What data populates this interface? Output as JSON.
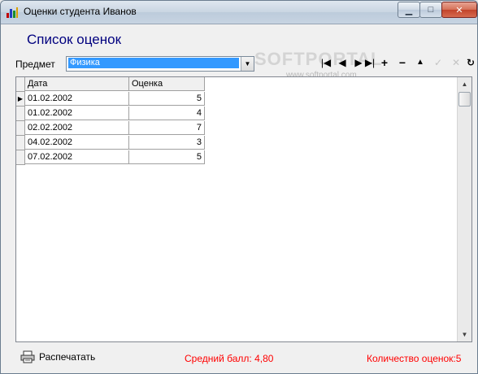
{
  "window": {
    "title": "Оценки студента Иванов",
    "minimize_glyph": "▁",
    "maximize_glyph": "□",
    "close_glyph": "✕"
  },
  "heading": "Список оценок",
  "subject": {
    "label": "Предмет",
    "value": "Физика",
    "dropdown_glyph": "▼"
  },
  "navigator": {
    "first": "|◀",
    "prior": "◀",
    "next": "▶",
    "last": "▶|",
    "insert": "+",
    "delete": "−",
    "edit": "▲",
    "post": "✓",
    "cancel": "✕",
    "refresh": "↻"
  },
  "watermark": {
    "text": "SOFTPORTAL",
    "sub": "www.softportal.com"
  },
  "grid": {
    "columns": [
      "Дата",
      "Оценка"
    ],
    "current_row_marker": "▶",
    "rows": [
      {
        "date": "01.02.2002",
        "grade": "5"
      },
      {
        "date": "01.02.2002",
        "grade": "4"
      },
      {
        "date": "02.02.2002",
        "grade": "7"
      },
      {
        "date": "04.02.2002",
        "grade": "3"
      },
      {
        "date": "07.02.2002",
        "grade": "5"
      }
    ],
    "scroll_up": "▲",
    "scroll_down": "▼"
  },
  "footer": {
    "print_label": "Распечатать",
    "average": "Средний балл: 4,80",
    "count": "Количество оценок:5"
  },
  "colors": {
    "heading": "#00007f",
    "selection": "#3399ff",
    "summary_text": "#ff0000"
  }
}
